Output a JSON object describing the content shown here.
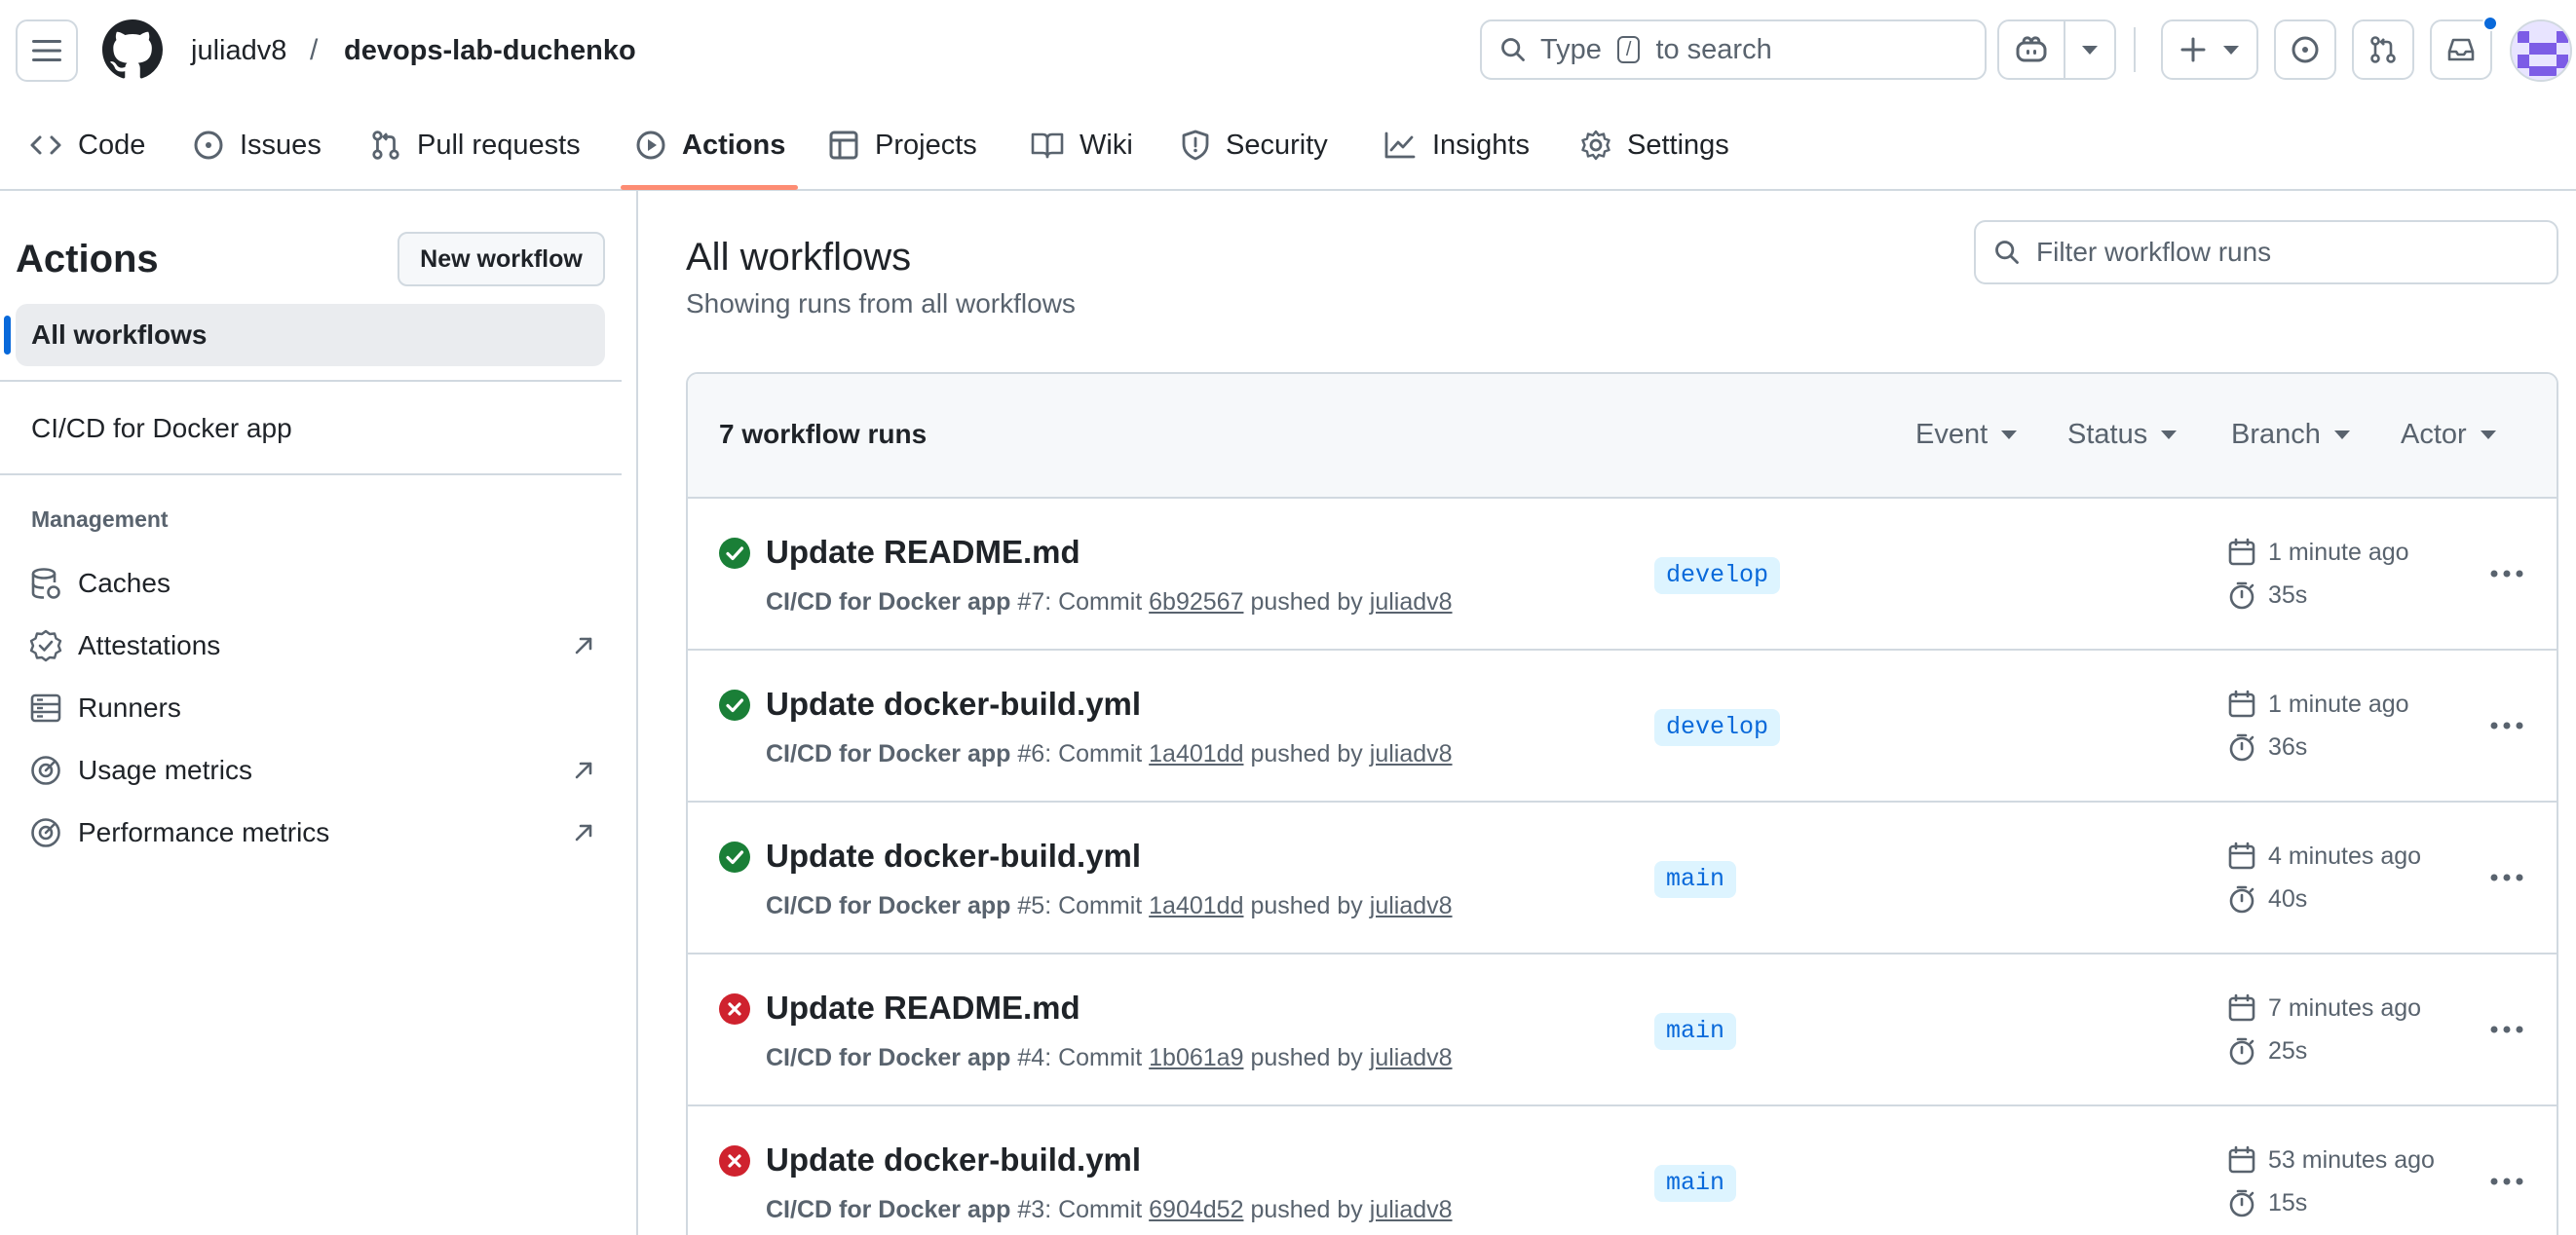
{
  "header": {
    "owner": "juliadv8",
    "separator": "/",
    "repo": "devops-lab-duchenko",
    "search": {
      "prefix": "Type",
      "key": "/",
      "suffix": "to search"
    }
  },
  "repo_nav": {
    "tabs": [
      {
        "label": "Code",
        "icon": "code-icon"
      },
      {
        "label": "Issues",
        "icon": "issue-icon"
      },
      {
        "label": "Pull requests",
        "icon": "pull-request-icon"
      },
      {
        "label": "Actions",
        "icon": "play-icon",
        "active": true
      },
      {
        "label": "Projects",
        "icon": "table-icon"
      },
      {
        "label": "Wiki",
        "icon": "book-icon"
      },
      {
        "label": "Security",
        "icon": "shield-icon"
      },
      {
        "label": "Insights",
        "icon": "graph-icon"
      },
      {
        "label": "Settings",
        "icon": "gear-icon"
      }
    ]
  },
  "sidebar": {
    "title": "Actions",
    "new_workflow": "New workflow",
    "all_workflows": "All workflows",
    "workflows": [
      "CI/CD for Docker app"
    ],
    "management_title": "Management",
    "management": [
      {
        "label": "Caches",
        "icon": "database-icon",
        "external": false
      },
      {
        "label": "Attestations",
        "icon": "verified-icon",
        "external": true
      },
      {
        "label": "Runners",
        "icon": "server-icon",
        "external": false
      },
      {
        "label": "Usage metrics",
        "icon": "meter-icon",
        "external": true
      },
      {
        "label": "Performance metrics",
        "icon": "meter-icon",
        "external": true
      }
    ]
  },
  "main": {
    "title": "All workflows",
    "subtitle": "Showing runs from all workflows",
    "filter_placeholder": "Filter workflow runs",
    "runs_count": "7 workflow runs",
    "filters": [
      "Event",
      "Status",
      "Branch",
      "Actor"
    ],
    "runs": [
      {
        "status": "success",
        "title": "Update README.md",
        "workflow": "CI/CD for Docker app",
        "number": "#7",
        "commit_label": ": Commit",
        "commit": "6b92567",
        "pushed_by": "pushed by",
        "actor": "juliadv8",
        "branch": "develop",
        "when": "1 minute ago",
        "duration": "35s"
      },
      {
        "status": "success",
        "title": "Update docker-build.yml",
        "workflow": "CI/CD for Docker app",
        "number": "#6",
        "commit_label": ": Commit",
        "commit": "1a401dd",
        "pushed_by": "pushed by",
        "actor": "juliadv8",
        "branch": "develop",
        "when": "1 minute ago",
        "duration": "36s"
      },
      {
        "status": "success",
        "title": "Update docker-build.yml",
        "workflow": "CI/CD for Docker app",
        "number": "#5",
        "commit_label": ": Commit",
        "commit": "1a401dd",
        "pushed_by": "pushed by",
        "actor": "juliadv8",
        "branch": "main",
        "when": "4 minutes ago",
        "duration": "40s"
      },
      {
        "status": "failure",
        "title": "Update README.md",
        "workflow": "CI/CD for Docker app",
        "number": "#4",
        "commit_label": ": Commit",
        "commit": "1b061a9",
        "pushed_by": "pushed by",
        "actor": "juliadv8",
        "branch": "main",
        "when": "7 minutes ago",
        "duration": "25s"
      },
      {
        "status": "failure",
        "title": "Update docker-build.yml",
        "workflow": "CI/CD for Docker app",
        "number": "#3",
        "commit_label": ": Commit",
        "commit": "6904d52",
        "pushed_by": "pushed by",
        "actor": "juliadv8",
        "branch": "main",
        "when": "53 minutes ago",
        "duration": "15s"
      }
    ]
  },
  "colors": {
    "success": "#1a7f37",
    "failure": "#cf222e",
    "accent": "#0969da",
    "tab_underline": "#fd8c73"
  }
}
